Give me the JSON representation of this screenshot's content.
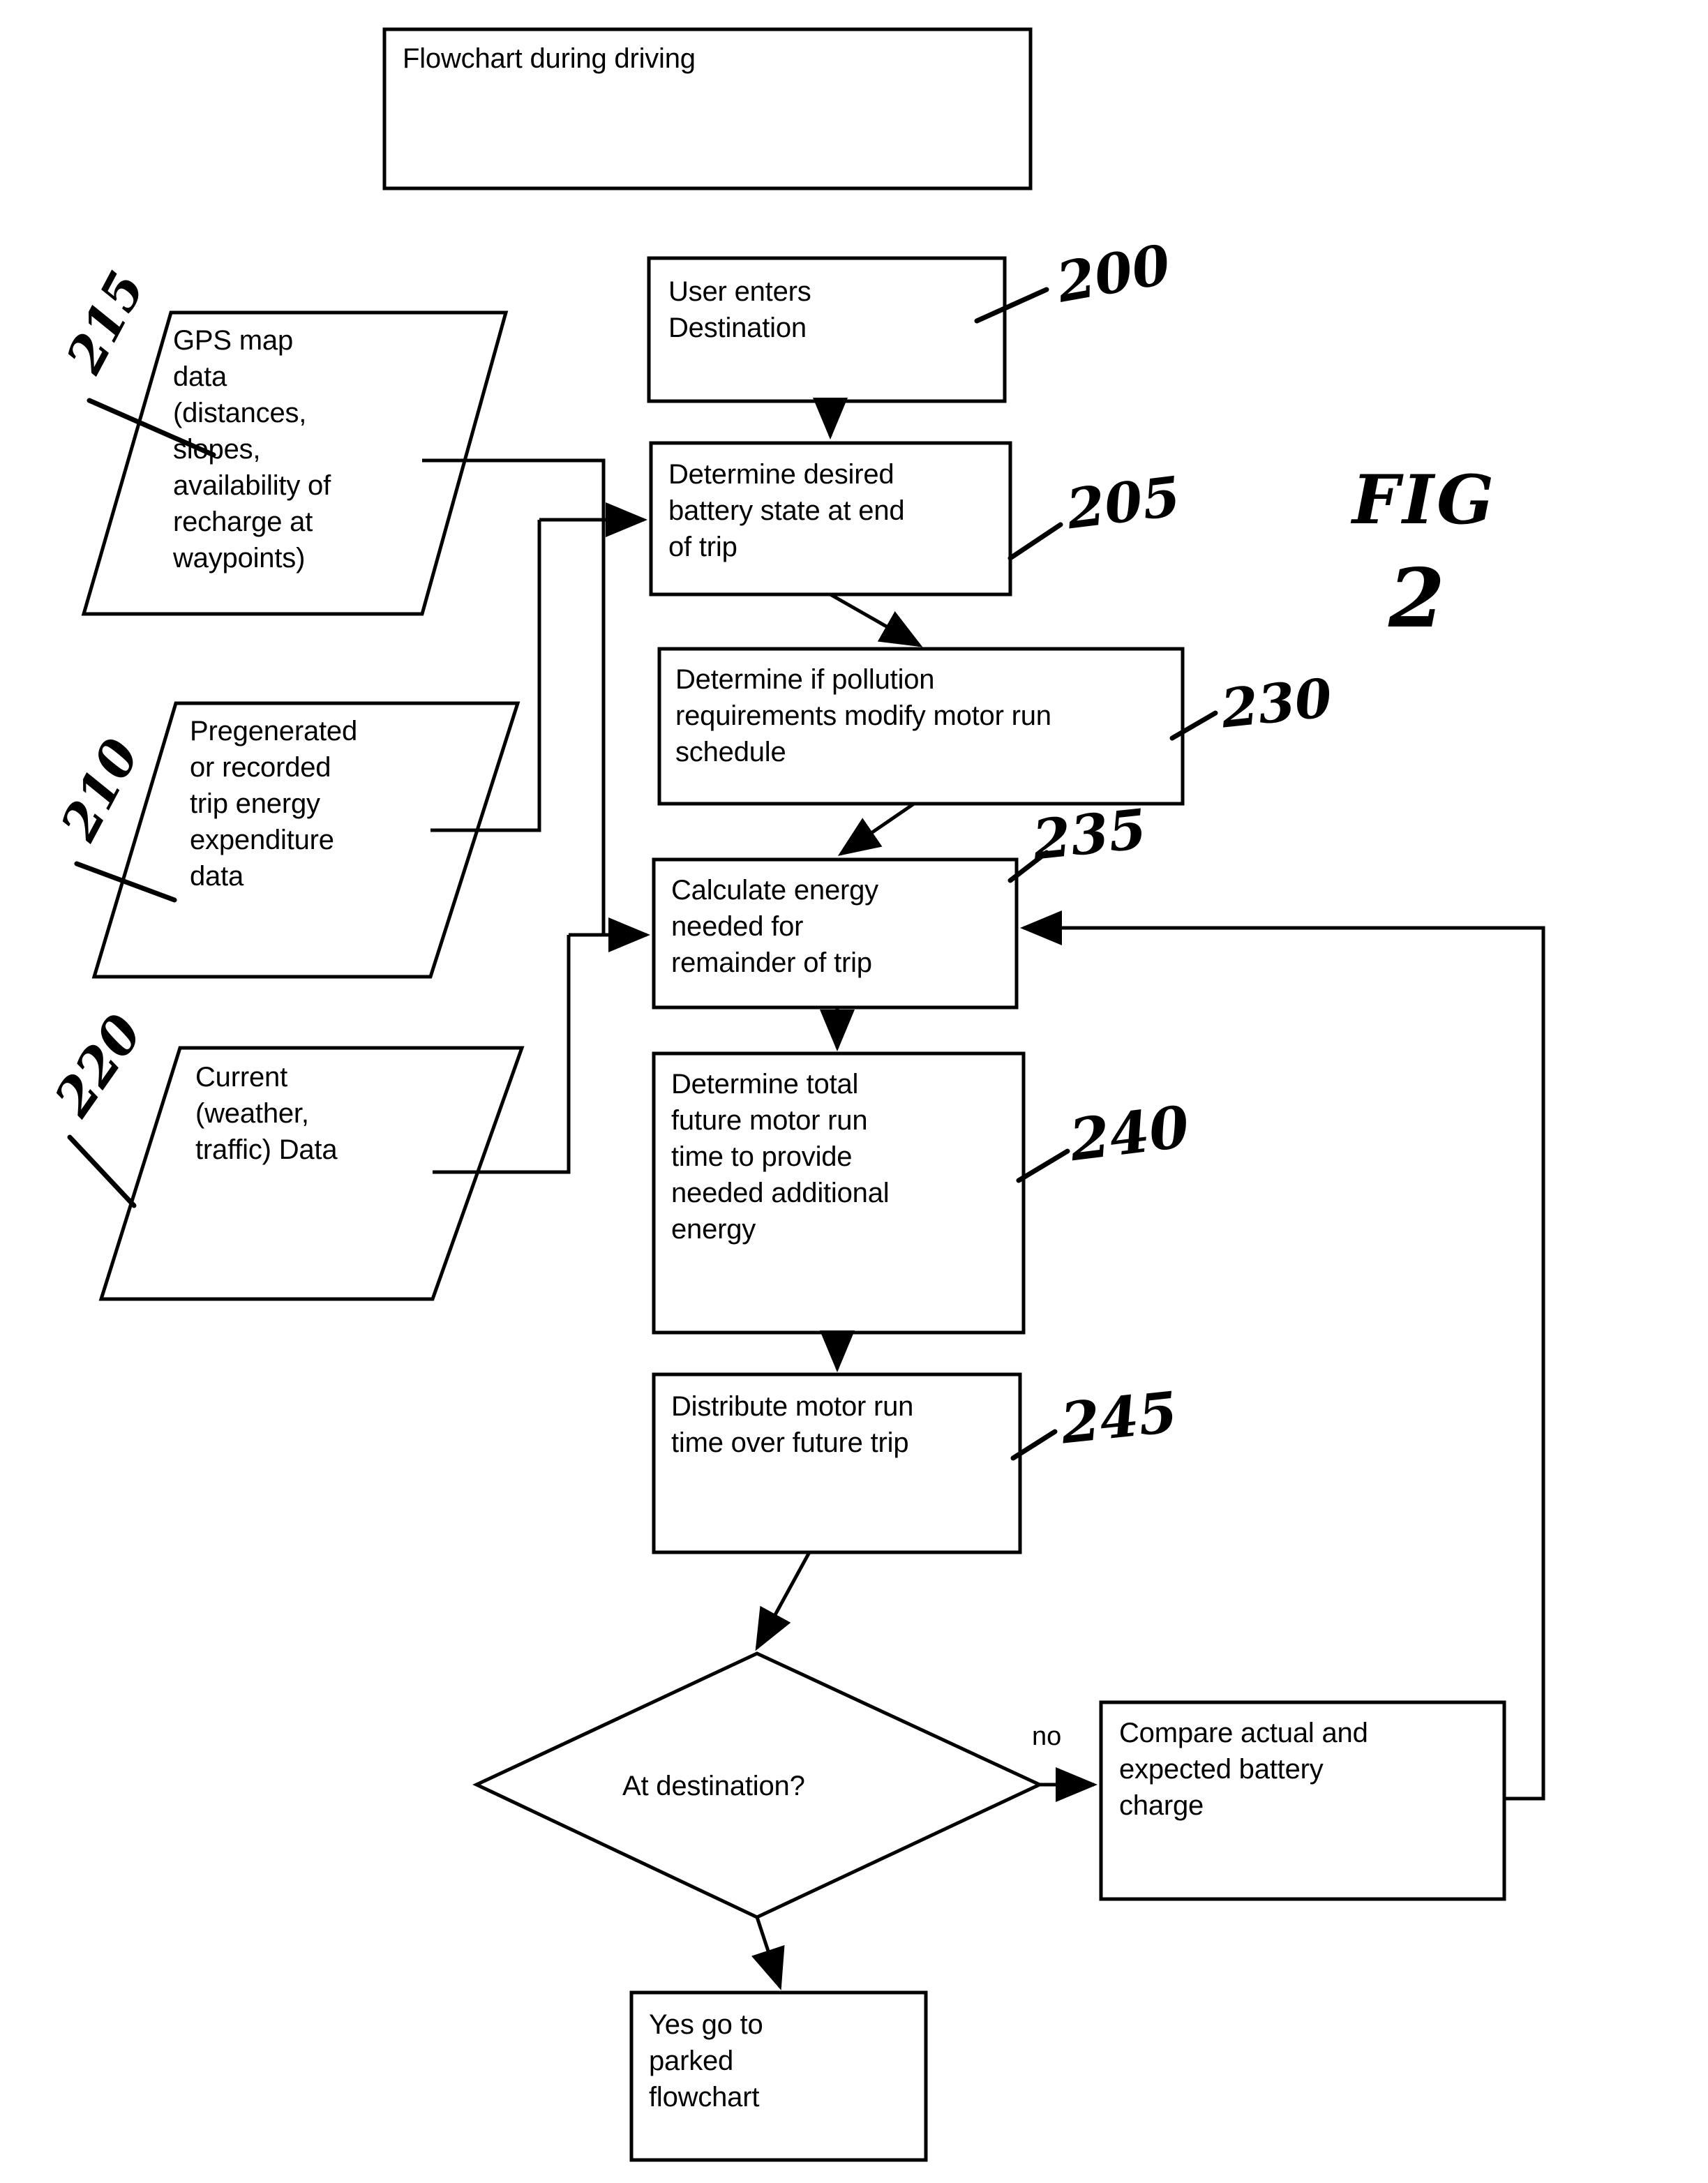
{
  "figure": {
    "title_box_label": "Flowchart during driving",
    "figure_annotation_line1": "FIG",
    "figure_annotation_line2": "2"
  },
  "nodes": {
    "title_box": {
      "label": "Flowchart during driving"
    },
    "user_enters_destination": {
      "label": "User enters\nDestination",
      "ref": "200"
    },
    "determine_battery_state": {
      "label": "Determine desired\nbattery state at end\nof trip",
      "ref": "205"
    },
    "pollution_requirements": {
      "label": "Determine if pollution\nrequirements modify motor run\nschedule",
      "ref": "230"
    },
    "calculate_energy": {
      "label": "Calculate energy\nneeded for\nremainder of trip",
      "ref": "235"
    },
    "motor_run_time": {
      "label": "Determine total\nfuture motor run\ntime to provide\nneeded additional\nenergy",
      "ref": "240"
    },
    "distribute_run_time": {
      "label": "Distribute motor run\ntime over future trip",
      "ref": "245"
    },
    "at_destination_decision": {
      "label": "At destination?"
    },
    "compare_battery_charge": {
      "label": "Compare actual and\nexpected battery\ncharge"
    },
    "yes_go_to_parked": {
      "label": "Yes go to\nparked\nflowchart"
    },
    "gps_map_data": {
      "label": "GPS map\ndata\n(distances,\nslopes,\navailability of\nrecharge at\nwaypoints)",
      "ref": "215"
    },
    "trip_energy_data": {
      "label": "Pregenerated\nor recorded\ntrip energy\nexpenditure\ndata",
      "ref": "210"
    },
    "current_data": {
      "label": "Current\n(weather,\ntraffic) Data",
      "ref": "220"
    }
  },
  "edges": {
    "no_branch_label": "no"
  },
  "chart_data": {
    "type": "diagram",
    "title": "Flowchart during driving",
    "diagram_kind": "flowchart",
    "nodes": [
      {
        "id": "200",
        "shape": "process",
        "text": "User enters Destination"
      },
      {
        "id": "205",
        "shape": "process",
        "text": "Determine desired battery state at end of trip"
      },
      {
        "id": "230",
        "shape": "process",
        "text": "Determine if pollution requirements modify motor run schedule"
      },
      {
        "id": "235",
        "shape": "process",
        "text": "Calculate energy needed for remainder of trip"
      },
      {
        "id": "240",
        "shape": "process",
        "text": "Determine total future motor run time to provide needed additional energy"
      },
      {
        "id": "245",
        "shape": "process",
        "text": "Distribute motor run time over future trip"
      },
      {
        "id": "decision",
        "shape": "diamond",
        "text": "At destination?"
      },
      {
        "id": "compare",
        "shape": "process",
        "text": "Compare actual and expected battery charge"
      },
      {
        "id": "parked",
        "shape": "process",
        "text": "Yes go to parked flowchart"
      },
      {
        "id": "215",
        "shape": "data",
        "text": "GPS map data (distances, slopes, availability of recharge at waypoints)"
      },
      {
        "id": "210",
        "shape": "data",
        "text": "Pregenerated or recorded trip energy expenditure data"
      },
      {
        "id": "220",
        "shape": "data",
        "text": "Current (weather, traffic) Data"
      }
    ],
    "edges": [
      {
        "from": "200",
        "to": "205",
        "label": ""
      },
      {
        "from": "205",
        "to": "230",
        "label": ""
      },
      {
        "from": "230",
        "to": "235",
        "label": ""
      },
      {
        "from": "235",
        "to": "240",
        "label": ""
      },
      {
        "from": "240",
        "to": "245",
        "label": ""
      },
      {
        "from": "245",
        "to": "decision",
        "label": ""
      },
      {
        "from": "decision",
        "to": "compare",
        "label": "no"
      },
      {
        "from": "decision",
        "to": "parked",
        "label": "yes"
      },
      {
        "from": "compare",
        "to": "235",
        "label": ""
      },
      {
        "from": "215",
        "to": "205",
        "label": ""
      },
      {
        "from": "215",
        "to": "235",
        "label": ""
      },
      {
        "from": "210",
        "to": "205",
        "label": ""
      },
      {
        "from": "210",
        "to": "235",
        "label": ""
      },
      {
        "from": "220",
        "to": "235",
        "label": ""
      }
    ]
  }
}
